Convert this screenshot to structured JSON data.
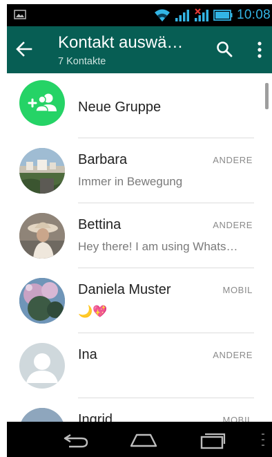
{
  "status_bar": {
    "time": "10:08",
    "icons": [
      "image-notification-icon",
      "wifi-icon",
      "signal-icon",
      "no-sim-signal-icon",
      "battery-icon"
    ],
    "accent_color": "#33b5e5"
  },
  "app_bar": {
    "title": "Kontakt auswä…",
    "subtitle": "7 Kontakte",
    "background": "#075e54",
    "icons": [
      "back-arrow-icon",
      "search-icon",
      "more-vertical-icon"
    ]
  },
  "list": {
    "new_group": {
      "label": "Neue Gruppe",
      "icon": "add-group-icon",
      "color": "#25d366"
    },
    "contacts": [
      {
        "name": "Barbara",
        "status": "Immer in Bewegung",
        "type": "ANDERE"
      },
      {
        "name": "Bettina",
        "status": "Hey there! I am using Whats…",
        "type": "ANDERE"
      },
      {
        "name": "Daniela Muster",
        "status": "🌙💖",
        "type": "MOBIL"
      },
      {
        "name": "Ina",
        "status": "",
        "type": "ANDERE"
      },
      {
        "name": "Ingrid",
        "status": "",
        "type": "MOBIL"
      }
    ]
  },
  "nav_bar": {
    "icons": [
      "nav-back-icon",
      "nav-home-icon",
      "nav-recent-apps-icon",
      "nav-menu-icon"
    ]
  }
}
